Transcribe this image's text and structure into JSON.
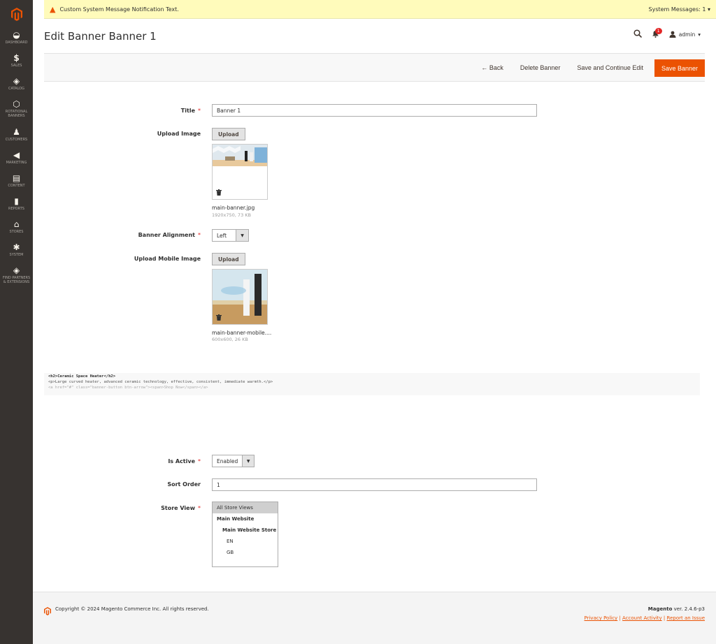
{
  "sidebar": {
    "items": [
      {
        "label": "DASHBOARD",
        "icon": "speedometer-icon"
      },
      {
        "label": "SALES",
        "icon": "dollar-icon"
      },
      {
        "label": "CATALOG",
        "icon": "cube-icon"
      },
      {
        "label": "ROTATIONAL BANNERS",
        "icon": "hexagon-icon"
      },
      {
        "label": "CUSTOMERS",
        "icon": "person-icon"
      },
      {
        "label": "MARKETING",
        "icon": "megaphone-icon"
      },
      {
        "label": "CONTENT",
        "icon": "layout-icon"
      },
      {
        "label": "REPORTS",
        "icon": "bar-chart-icon"
      },
      {
        "label": "STORES",
        "icon": "store-icon"
      },
      {
        "label": "SYSTEM",
        "icon": "gear-icon"
      },
      {
        "label": "FIND PARTNERS & EXTENSIONS",
        "icon": "box-icon"
      }
    ]
  },
  "system_message": {
    "text": "Custom System Message Notification Text.",
    "counter": "System Messages: 1"
  },
  "header": {
    "title": "Edit Banner Banner 1",
    "notification_count": "1",
    "user": "admin"
  },
  "toolbar": {
    "back": "Back",
    "delete": "Delete Banner",
    "save_continue": "Save and Continue Edit",
    "save": "Save Banner"
  },
  "form": {
    "title_label": "Title",
    "title_value": "Banner 1",
    "upload_image_label": "Upload Image",
    "upload_button": "Upload",
    "image_file": "main-banner.jpg",
    "image_meta": "1920x750, 73 KB",
    "alignment_label": "Banner Alignment",
    "alignment_value": "Left",
    "upload_mobile_label": "Upload Mobile Image",
    "mobile_file": "main-banner-mobile....",
    "mobile_meta": "600x600, 26 KB",
    "code_line1": "<h2>Ceramic Space Heater</h2>",
    "code_line2": "<p>Large curved heater, advanced ceramic technology, effective, consistent, immediate warmth.</p>",
    "code_line3": "<a href=\"#\" class=\"banner-button btn-arrow\"><span>Shop Now</span></a>",
    "active_label": "Is Active",
    "active_value": "Enabled",
    "sort_label": "Sort Order",
    "sort_value": "1",
    "store_label": "Store View",
    "store_options": [
      "All Store Views",
      "Main Website",
      "Main Website Store",
      "EN",
      "GB"
    ]
  },
  "footer": {
    "copyright": "Copyright © 2024 Magento Commerce Inc. All rights reserved.",
    "brand": "Magento",
    "version": "ver. 2.4.6-p3",
    "privacy": "Privacy Policy",
    "activity": "Account Activity",
    "report": "Report an Issue"
  },
  "colors": {
    "accent": "#eb5202",
    "sidebar": "#373330",
    "message_bg": "#fffbbb"
  }
}
